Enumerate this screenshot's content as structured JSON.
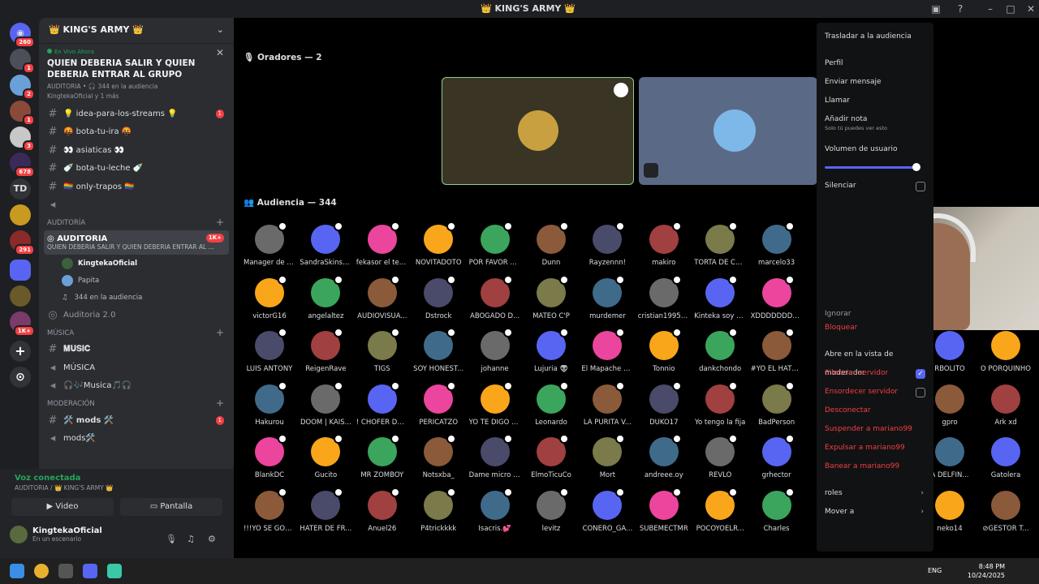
{
  "window": {
    "title": "👑 KING'S ARMY 👑"
  },
  "guilds": [
    {
      "badge": "260"
    },
    {
      "badge": "1"
    },
    {
      "badge": "2"
    },
    {
      "badge": "1"
    },
    {
      "badge": "3"
    },
    {
      "badge": "678"
    },
    {
      "label": "TD"
    },
    {
      "badge": ""
    },
    {
      "badge": "291"
    },
    {
      "badge": ""
    },
    {
      "badge": ""
    },
    {
      "badge": "1K+"
    }
  ],
  "server": {
    "name": "👑 KING'S ARMY 👑"
  },
  "live": {
    "status": "En Vivo Ahora",
    "title": "QUIEN DEBERIA SALIR Y QUIEN DEBERIA ENTRAR AL GRUPO",
    "meta": "AUDITORIA • 🎧 344 en la audiencia",
    "meta2": "KingtekaOficial y 1 más"
  },
  "channels": [
    {
      "name": "💡 idea-para-los-streams 💡",
      "count": "1"
    },
    {
      "name": "🤬 bota-tu-ira 🤬",
      "count": ""
    },
    {
      "name": "👀 asiaticas 👀",
      "count": ""
    },
    {
      "name": "🍼 bota-tu-leche 🍼",
      "count": ""
    },
    {
      "name": "🏳️‍🌈 only-trapos 🏳️‍🌈",
      "count": ""
    }
  ],
  "cat_auditoria": "AUDITORÍA",
  "active_stage": {
    "name": "AUDITORIA",
    "badge": "1K+",
    "topic": "QUIEN DEBERIA SALIR Y QUIEN DEBERIA ENTRAR AL ..."
  },
  "stage_users": [
    "KingtekaOficial",
    "Papita",
    "344 en la audiencia"
  ],
  "auditoria2": "Auditoria 2.0",
  "cat_musica": "MÚSICA",
  "music_channels": [
    "𝐌𝐔𝐒𝐈𝐂",
    "MÚSICA",
    "🎧🎶Musica🎵🎧"
  ],
  "cat_moderacion": "MODERACIÓN",
  "mod_channels": [
    {
      "name": "🛠️ mods 🛠️",
      "count": "1"
    },
    {
      "name": "mods🛠️",
      "count": ""
    }
  ],
  "voice": {
    "status": "Voz conectada",
    "location": "AUDITORIA / 👑 KING'S ARMY 👑",
    "video": "Video",
    "screen": "Pantalla"
  },
  "user": {
    "name": "KingtekaOficial",
    "status": "En un escenario"
  },
  "speakers_header": "Oradores — 2",
  "audience_header": "Audiencia — 344",
  "audience": [
    [
      "Manager de R...",
      "SandraSkinsE...",
      "fekasor el terr...",
      "NOVITADOTO",
      "POR FAVOR A...",
      "Dunn",
      "Rayzennn!",
      "makiro",
      "TORTA DE CA...",
      "marcelo33"
    ],
    [
      "victorG16",
      "angelaltez",
      "AUDIOVISUA...",
      "Dstrock",
      "ABOGADO D...",
      "MATEO C'P",
      "murdemer",
      "cristian19952...",
      "Kinteka soy n...",
      "XDDDDDDDD..."
    ],
    [
      "LUIS ANTONY",
      "ReigenRave",
      "TIGS",
      "SOY HONEST...",
      "johanne",
      "Lujuria 👽",
      "El Mapache H...",
      "Tonnio",
      "dankchondo",
      "#YO EL HATE..."
    ],
    [
      "Hakurou",
      "DOOM | KAIS...",
      "! CHOFER DE ...",
      "PERICATZO",
      "YO TE DIGO E...",
      "Leonardo",
      "LA PURITA V...",
      "DUKO17",
      "Yo tengo la fija",
      "BadPerson"
    ],
    [
      "BlankDC",
      "Gucito",
      "MR ZOMBOY",
      "Notsxba_",
      "Dame micro k...",
      "ElmoTicuCo",
      "Mort",
      "andreee.oy",
      "REVLO",
      "grhector"
    ],
    [
      "!!!YO SE GOR...",
      "HATER DE FR...",
      "Anuel26",
      "P4trickkkk",
      "Isacris.💕",
      "levitz",
      "CONERO_GA...",
      "SUBEMECTMR",
      "POCOYOELR...",
      "Charles"
    ]
  ],
  "right_col": [
    "RBOLITO",
    "O PORQUINHO",
    "gpro",
    "Ark xd",
    "A DELFIN...",
    "Gatolera",
    "neko14",
    "⊘GESTOR T..."
  ],
  "menu": {
    "move_audience": "Trasladar a la audiencia",
    "profile": "Perfil",
    "message": "Enviar mensaje",
    "call": "Llamar",
    "note": "Añadir nota",
    "note_sub": "Solo tú puedes ver esto",
    "volume": "Volumen de usuario",
    "volume_level": 1.0,
    "mute": "Silenciar",
    "ignore": "Ignorar",
    "block": "Bloquear",
    "mod_view": "Abre en la vista de moderador",
    "server_mute": "Silenciar servidor",
    "server_deafen": "Ensordecer servidor",
    "disconnect": "Desconectar",
    "suspend": "Suspender a mariano99",
    "kick": "Expulsar a mariano99",
    "ban": "Banear a mariano99",
    "roles": "roles",
    "move": "Mover a"
  },
  "taskbar": {
    "lang": "ENG",
    "time": "8:48 PM",
    "date": "10/24/2025"
  },
  "colors": {
    "accent": "#5865f2",
    "danger": "#f23f43",
    "online": "#23a55a"
  }
}
